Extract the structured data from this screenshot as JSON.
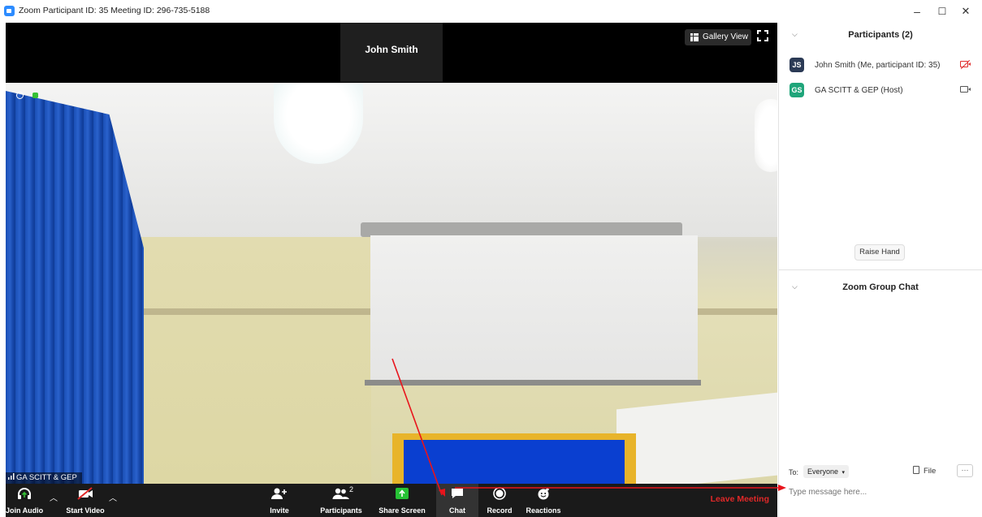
{
  "window": {
    "title": "Zoom Participant ID: 35   Meeting ID: 296-735-5188",
    "minimize": "–",
    "maximize": "☐",
    "close": "✕"
  },
  "video": {
    "active_speaker": "John Smith",
    "gallery_view_label": "Gallery View",
    "participant_tag": "GA SCITT & GEP"
  },
  "toolbar": {
    "join_audio": "Join Audio",
    "start_video": "Start Video",
    "invite": "Invite",
    "participants": "Participants",
    "participants_count": "2",
    "share_screen": "Share Screen",
    "chat": "Chat",
    "record": "Record",
    "reactions": "Reactions",
    "leave": "Leave Meeting"
  },
  "participants_panel": {
    "title": "Participants (2)",
    "items": [
      {
        "initials": "JS",
        "name": "John Smith (Me, participant ID: 35)",
        "avatar_color": "#2b3a55",
        "video_on": false
      },
      {
        "initials": "GS",
        "name": "GA SCITT & GEP (Host)",
        "avatar_color": "#1fa57a",
        "video_on": true
      }
    ],
    "raise_hand": "Raise Hand"
  },
  "chat_panel": {
    "title": "Zoom Group Chat",
    "to_label": "To:",
    "recipient": "Everyone",
    "file_label": "File",
    "more": "···",
    "placeholder": "Type message here..."
  },
  "colors": {
    "accent": "#2D8CFF",
    "leave": "#e02828",
    "annotation": "#e8141c",
    "share_green": "#26c235"
  }
}
